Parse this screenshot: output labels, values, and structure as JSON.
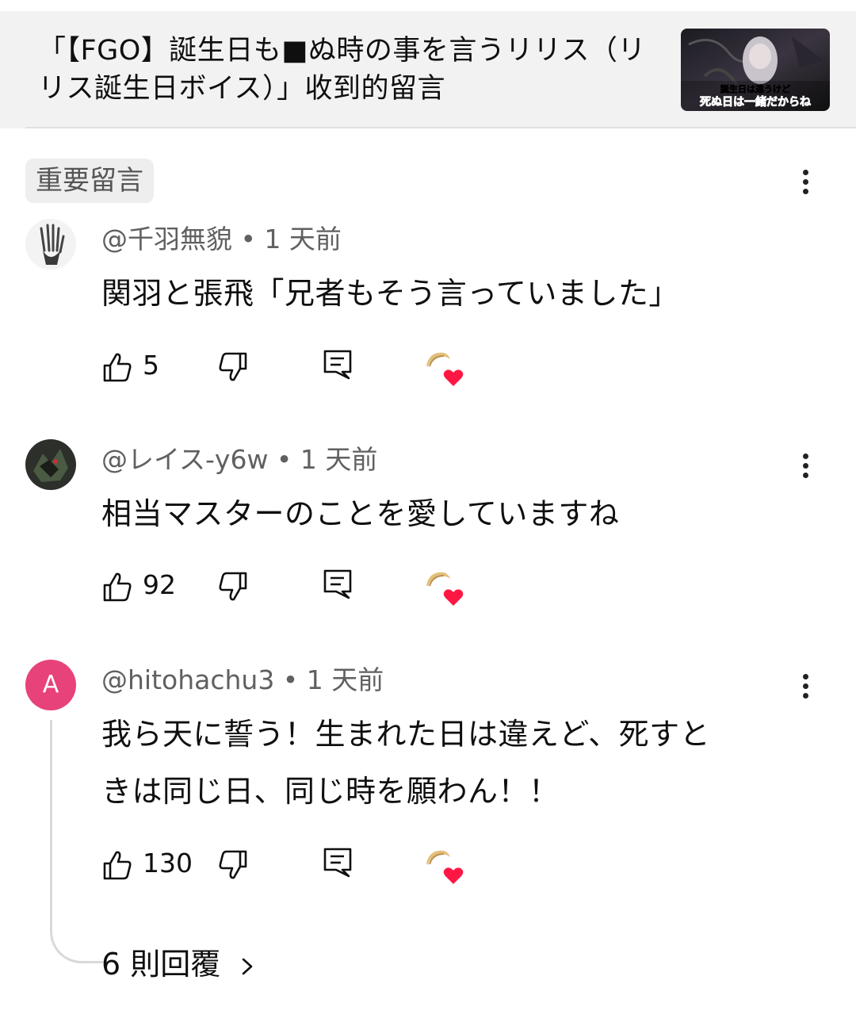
{
  "header": {
    "title": "「【FGO】誕生日も■ぬ時の事を言うリリス（リリス誕生日ボイス）」收到的留言",
    "thumbnail_caption_1": "誕生日は違うけど",
    "thumbnail_caption_2": "死ぬ日は一緒だからね"
  },
  "section": {
    "chip_label": "重要留言"
  },
  "comments": [
    {
      "author": "@千羽無貌",
      "time": "1 天前",
      "author_line": "@千羽無貌 • 1 天前",
      "text": "関羽と張飛「兄者もそう言っていました」",
      "likes": "5"
    },
    {
      "author": "@レイス-y6w",
      "time": "1 天前",
      "author_line": "@レイス-y6w • 1 天前",
      "text": "相当マスターのことを愛していますね",
      "likes": "92"
    },
    {
      "author": "@hitohachu3",
      "time": "1 天前",
      "author_line": "@hitohachu3 • 1 天前",
      "avatar_letter": "A",
      "text_line_1": "我ら天に誓う！生まれた日は違えど、死すと",
      "text_line_2": "きは同じ日、同じ時を願わん！！",
      "likes": "130",
      "replies_label": "6 則回覆"
    }
  ],
  "colors": {
    "header_bg": "#f2f2f2",
    "avatar_letter_bg": "#e8427a",
    "heart": "#ff1744",
    "secondary_text": "#606060"
  },
  "icons": [
    "like-icon",
    "dislike-icon",
    "reply-icon",
    "creator-heart-icon",
    "more-vert-icon",
    "chevron-right-icon"
  ]
}
